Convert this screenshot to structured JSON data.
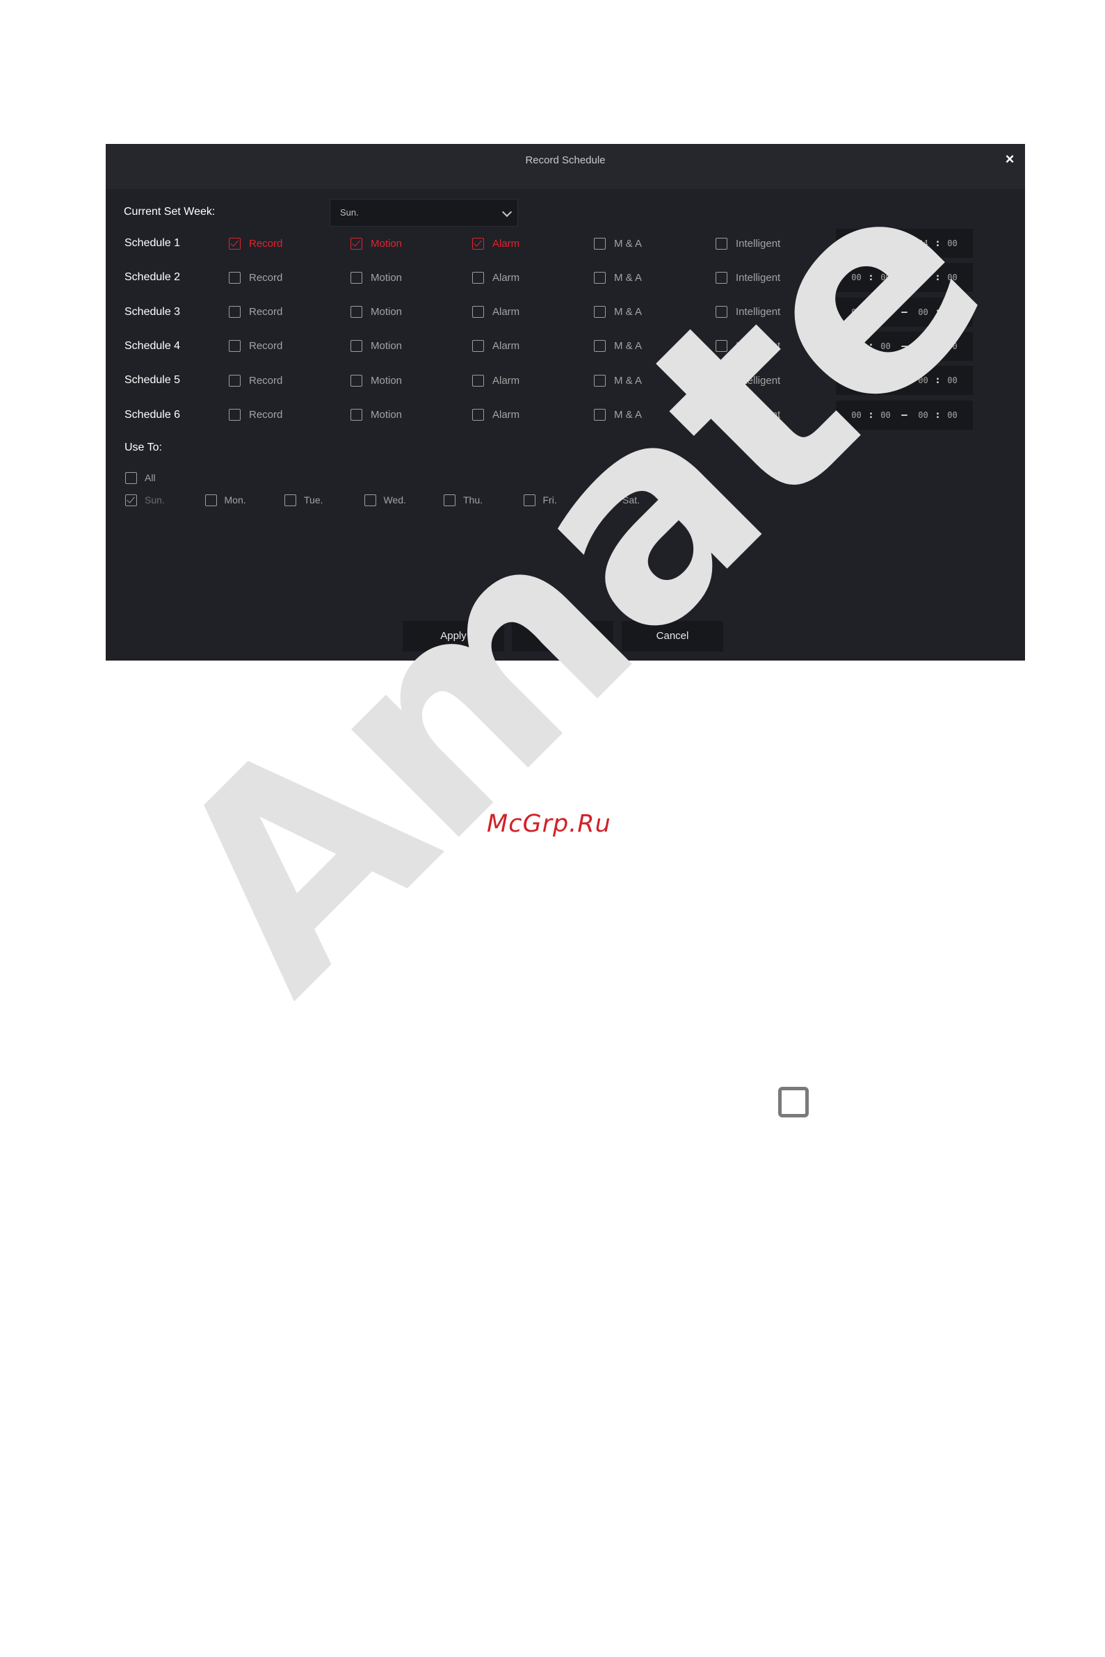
{
  "dialog": {
    "title": "Record Schedule",
    "close_glyph": "×",
    "current_set_week_label": "Current Set Week:",
    "current_set_week_value": "Sun.",
    "schedules": [
      {
        "label": "Schedule 1",
        "record": true,
        "motion": true,
        "alarm": true,
        "ma": false,
        "intelligent": false,
        "start_h": "00",
        "start_m": "00",
        "end_h": "24",
        "end_m": "00"
      },
      {
        "label": "Schedule 2",
        "record": false,
        "motion": false,
        "alarm": false,
        "ma": false,
        "intelligent": false,
        "start_h": "00",
        "start_m": "00",
        "end_h": "00",
        "end_m": "00"
      },
      {
        "label": "Schedule 3",
        "record": false,
        "motion": false,
        "alarm": false,
        "ma": false,
        "intelligent": false,
        "start_h": "00",
        "start_m": "00",
        "end_h": "00",
        "end_m": "00"
      },
      {
        "label": "Schedule 4",
        "record": false,
        "motion": false,
        "alarm": false,
        "ma": false,
        "intelligent": false,
        "start_h": "00",
        "start_m": "00",
        "end_h": "00",
        "end_m": "00"
      },
      {
        "label": "Schedule 5",
        "record": false,
        "motion": false,
        "alarm": false,
        "ma": false,
        "intelligent": false,
        "start_h": "00",
        "start_m": "00",
        "end_h": "00",
        "end_m": "00"
      },
      {
        "label": "Schedule 6",
        "record": false,
        "motion": false,
        "alarm": false,
        "ma": false,
        "intelligent": false,
        "start_h": "00",
        "start_m": "00",
        "end_h": "00",
        "end_m": "00"
      }
    ],
    "options": {
      "record": "Record",
      "motion": "Motion",
      "alarm": "Alarm",
      "ma": "M & A",
      "intelligent": "Intelligent"
    },
    "time_separator": ":",
    "time_dash": "–",
    "use_to_label": "Use To:",
    "all_label": "All",
    "all_checked": false,
    "days": [
      {
        "label": "Sun.",
        "checked": true,
        "disabled": true
      },
      {
        "label": "Mon.",
        "checked": false,
        "disabled": false
      },
      {
        "label": "Tue.",
        "checked": false,
        "disabled": false
      },
      {
        "label": "Wed.",
        "checked": false,
        "disabled": false
      },
      {
        "label": "Thu.",
        "checked": false,
        "disabled": false
      },
      {
        "label": "Fri.",
        "checked": false,
        "disabled": false
      },
      {
        "label": "Sat.",
        "checked": false,
        "disabled": false
      }
    ],
    "buttons": {
      "apply": "Apply",
      "save": "Save",
      "cancel": "Cancel"
    }
  },
  "page": {
    "watermark": "Amate",
    "site_mark": "McGrp.Ru"
  },
  "colors": {
    "accent_red": "#e0242d",
    "dialog_bg": "#202127",
    "field_bg": "#17181c"
  }
}
